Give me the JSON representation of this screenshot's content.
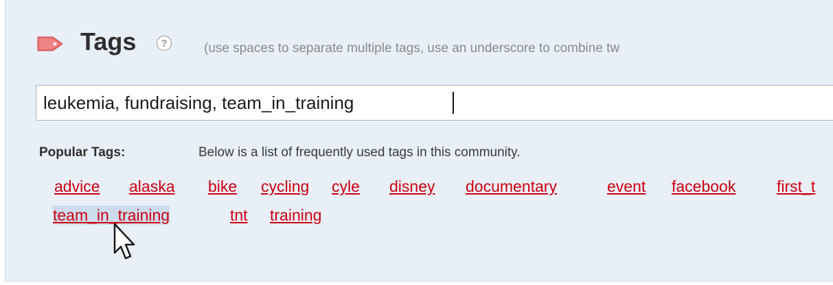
{
  "tags_section": {
    "title": "Tags",
    "help_glyph": "?",
    "hint": "(use spaces to separate multiple tags, use an underscore to combine tw",
    "input_value": "leukemia, fundraising, team_in_training",
    "icon": "tag-icon",
    "icon_color": "#e86a6a"
  },
  "popular": {
    "label": "Popular Tags:",
    "description": "Below is a list of frequently used tags in this community.",
    "tags": [
      "advice",
      "alaska",
      "bike",
      "cycling",
      "cyle",
      "disney",
      "documentary",
      "event",
      "facebook",
      "first_t",
      "team_in_training",
      "tnt",
      "training"
    ],
    "link_color": "#cc0011",
    "hovered_tag": "team_in_training"
  }
}
